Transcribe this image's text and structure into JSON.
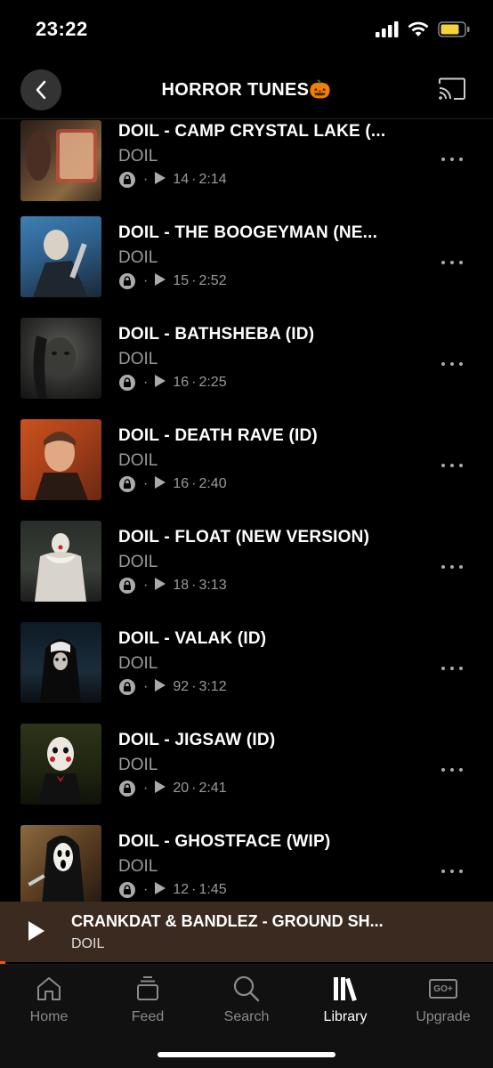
{
  "status": {
    "time": "23:22"
  },
  "header": {
    "title": "HORROR TUNES🎃"
  },
  "tracks": [
    {
      "title": "DOIL - CAMP CRYSTAL LAKE (...",
      "artist": "DOIL",
      "plays": "14",
      "duration": "2:14",
      "sep": "·"
    },
    {
      "title": "DOIL - THE BOOGEYMAN (NE...",
      "artist": "DOIL",
      "plays": "15",
      "duration": "2:52",
      "sep": "·"
    },
    {
      "title": "DOIL - BATHSHEBA (ID)",
      "artist": "DOIL",
      "plays": "16",
      "duration": "2:25",
      "sep": "·"
    },
    {
      "title": "DOIL - DEATH RAVE (ID)",
      "artist": "DOIL",
      "plays": "16",
      "duration": "2:40",
      "sep": "·"
    },
    {
      "title": "DOIL - FLOAT (NEW VERSION)",
      "artist": "DOIL",
      "plays": "18",
      "duration": "3:13",
      "sep": "·"
    },
    {
      "title": "DOIL - VALAK (ID)",
      "artist": "DOIL",
      "plays": "92",
      "duration": "3:12",
      "sep": "·"
    },
    {
      "title": "DOIL - JIGSAW (ID)",
      "artist": "DOIL",
      "plays": "20",
      "duration": "2:41",
      "sep": "·"
    },
    {
      "title": "DOIL - GHOSTFACE (WIP)",
      "artist": "DOIL",
      "plays": "12",
      "duration": "1:45",
      "sep": "·"
    }
  ],
  "now_playing": {
    "title": "CRANKDAT & BANDLEZ - GROUND SH...",
    "artist": "DOIL",
    "progress": 0.01
  },
  "tabs": [
    {
      "label": "Home",
      "icon": "home-icon"
    },
    {
      "label": "Feed",
      "icon": "feed-icon"
    },
    {
      "label": "Search",
      "icon": "search-icon"
    },
    {
      "label": "Library",
      "icon": "library-icon",
      "active": true
    },
    {
      "label": "Upgrade",
      "icon": "upgrade-icon",
      "badge": "GO+"
    }
  ]
}
